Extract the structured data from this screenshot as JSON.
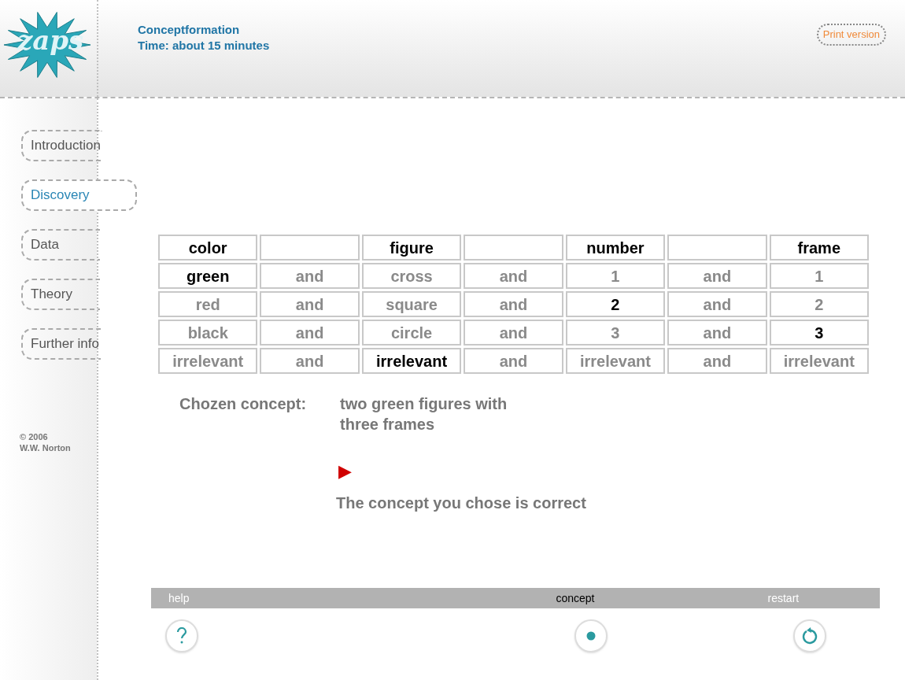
{
  "logo": "zaps",
  "header": {
    "title": "Conceptformation",
    "subtitle": "Time: about 15 minutes",
    "print_button": "Print version"
  },
  "sidebar": {
    "items": [
      {
        "label": "Introduction",
        "selected": false
      },
      {
        "label": "Discovery",
        "selected": true
      },
      {
        "label": "Data",
        "selected": false
      },
      {
        "label": "Theory",
        "selected": false
      },
      {
        "label": "Further info",
        "selected": false
      }
    ],
    "copyright": [
      "© 2006",
      "W.W. Norton"
    ]
  },
  "table": {
    "columns": [
      "color",
      "",
      "figure",
      "",
      "number",
      "",
      "frame"
    ],
    "rows": [
      [
        {
          "text": "green",
          "selected": true
        },
        {
          "text": "and",
          "selected": false
        },
        {
          "text": "cross",
          "selected": false
        },
        {
          "text": "and",
          "selected": false
        },
        {
          "text": "1",
          "selected": false
        },
        {
          "text": "and",
          "selected": false
        },
        {
          "text": "1",
          "selected": false
        }
      ],
      [
        {
          "text": "red",
          "selected": false
        },
        {
          "text": "and",
          "selected": false
        },
        {
          "text": "square",
          "selected": false
        },
        {
          "text": "and",
          "selected": false
        },
        {
          "text": "2",
          "selected": true
        },
        {
          "text": "and",
          "selected": false
        },
        {
          "text": "2",
          "selected": false
        }
      ],
      [
        {
          "text": "black",
          "selected": false
        },
        {
          "text": "and",
          "selected": false
        },
        {
          "text": "circle",
          "selected": false
        },
        {
          "text": "and",
          "selected": false
        },
        {
          "text": "3",
          "selected": false
        },
        {
          "text": "and",
          "selected": false
        },
        {
          "text": "3",
          "selected": true
        }
      ],
      [
        {
          "text": "irrelevant",
          "selected": false
        },
        {
          "text": "and",
          "selected": false
        },
        {
          "text": "irrelevant",
          "selected": true
        },
        {
          "text": "and",
          "selected": false
        },
        {
          "text": "irrelevant",
          "selected": false
        },
        {
          "text": "and",
          "selected": false
        },
        {
          "text": "irrelevant",
          "selected": false
        }
      ]
    ]
  },
  "chosen": {
    "label": "Chozen concept:",
    "value": [
      "two green figures with",
      "three frames"
    ]
  },
  "result": {
    "marker": "▶",
    "message": "The concept you chose is correct"
  },
  "toolbar": [
    {
      "label": "help",
      "kind": "help",
      "selected": false
    },
    {
      "label": "concept",
      "kind": "concept",
      "selected": true
    },
    {
      "label": "restart",
      "kind": "restart",
      "selected": false
    }
  ]
}
